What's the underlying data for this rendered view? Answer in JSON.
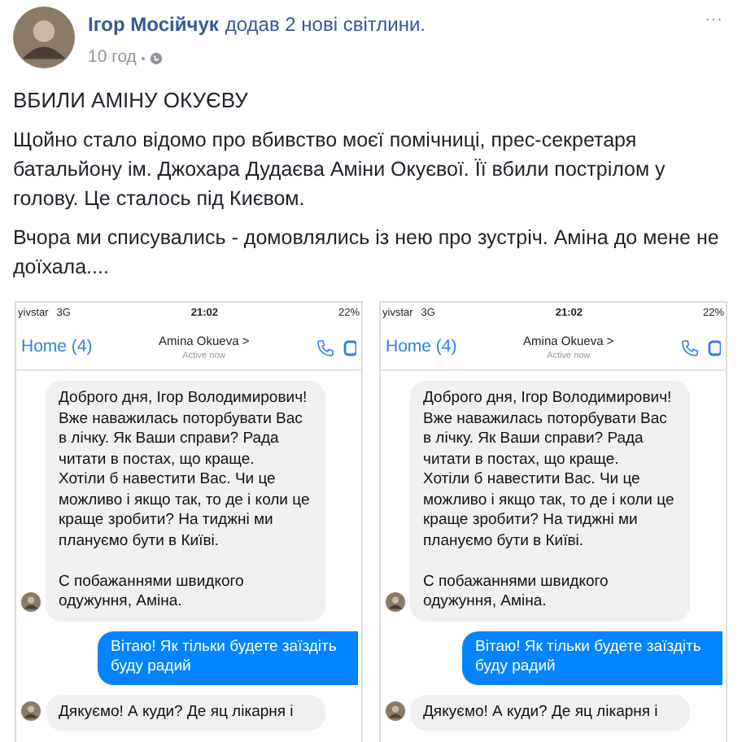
{
  "post": {
    "author": "Ігор Мосійчук",
    "action": "додав 2 нові світлини.",
    "time": "10 год",
    "menu": "···",
    "title": "ВБИЛИ АМІНУ ОКУЄВУ",
    "paragraphs": [
      "Щойно стало відомо про вбивство моєї помічниці, прес-секретаря батальйону ім. Джохара Дудаєва Аміни Окуєвої. Її вбили пострілом у голову. Це сталось під Києвом.",
      "Вчора ми списувались - домовлялись із нею про зустріч. Аміна до мене не доїхала...."
    ]
  },
  "photos": [
    {
      "carrier": "yivstar",
      "network": "3G",
      "clock": "21:02",
      "battery": "22%",
      "back": "Home (4)",
      "contact": "Amina Okueva >",
      "presence": "Active now",
      "messages": [
        {
          "kind": "received",
          "text": "Доброго дня, Ігор Володимирович! Вже наважилась поторбувати Вас в лічку. Як Ваши справи? Рада читати в постах, що краще.\nХотіли б навестити Вас. Чи це можливо і якщо так, то де і коли це краще зробити? На тиджні ми плануємо бути в Київі.\n\nС побажаннями швидкого одужуння, Аміна."
        },
        {
          "kind": "sent",
          "text": "Вітаю! Як тільки будете заїздіть буду радий"
        },
        {
          "kind": "received",
          "text": "Дякуємо! А куди? Де яц лікарня і"
        }
      ]
    },
    {
      "carrier": "yivstar",
      "network": "3G",
      "clock": "21:02",
      "battery": "22%",
      "back": "Home (4)",
      "contact": "Amina Okueva >",
      "presence": "Active now",
      "messages": [
        {
          "kind": "received",
          "text": "Доброго дня, Ігор Володимирович! Вже наважилась поторбувати Вас в лічку. Як Ваши справи? Рада читати в постах, що краще.\nХотіли б навестити Вас. Чи це можливо і якщо так, то де і коли це краще зробити? На тиджні ми плануємо бути в Київі.\n\nС побажаннями швидкого одужуння, Аміна."
        },
        {
          "kind": "sent",
          "text": "Вітаю! Як тільки будете заїздіть буду радий"
        },
        {
          "kind": "received",
          "text": "Дякуємо! А куди? Де яц лікарня і"
        }
      ]
    }
  ]
}
